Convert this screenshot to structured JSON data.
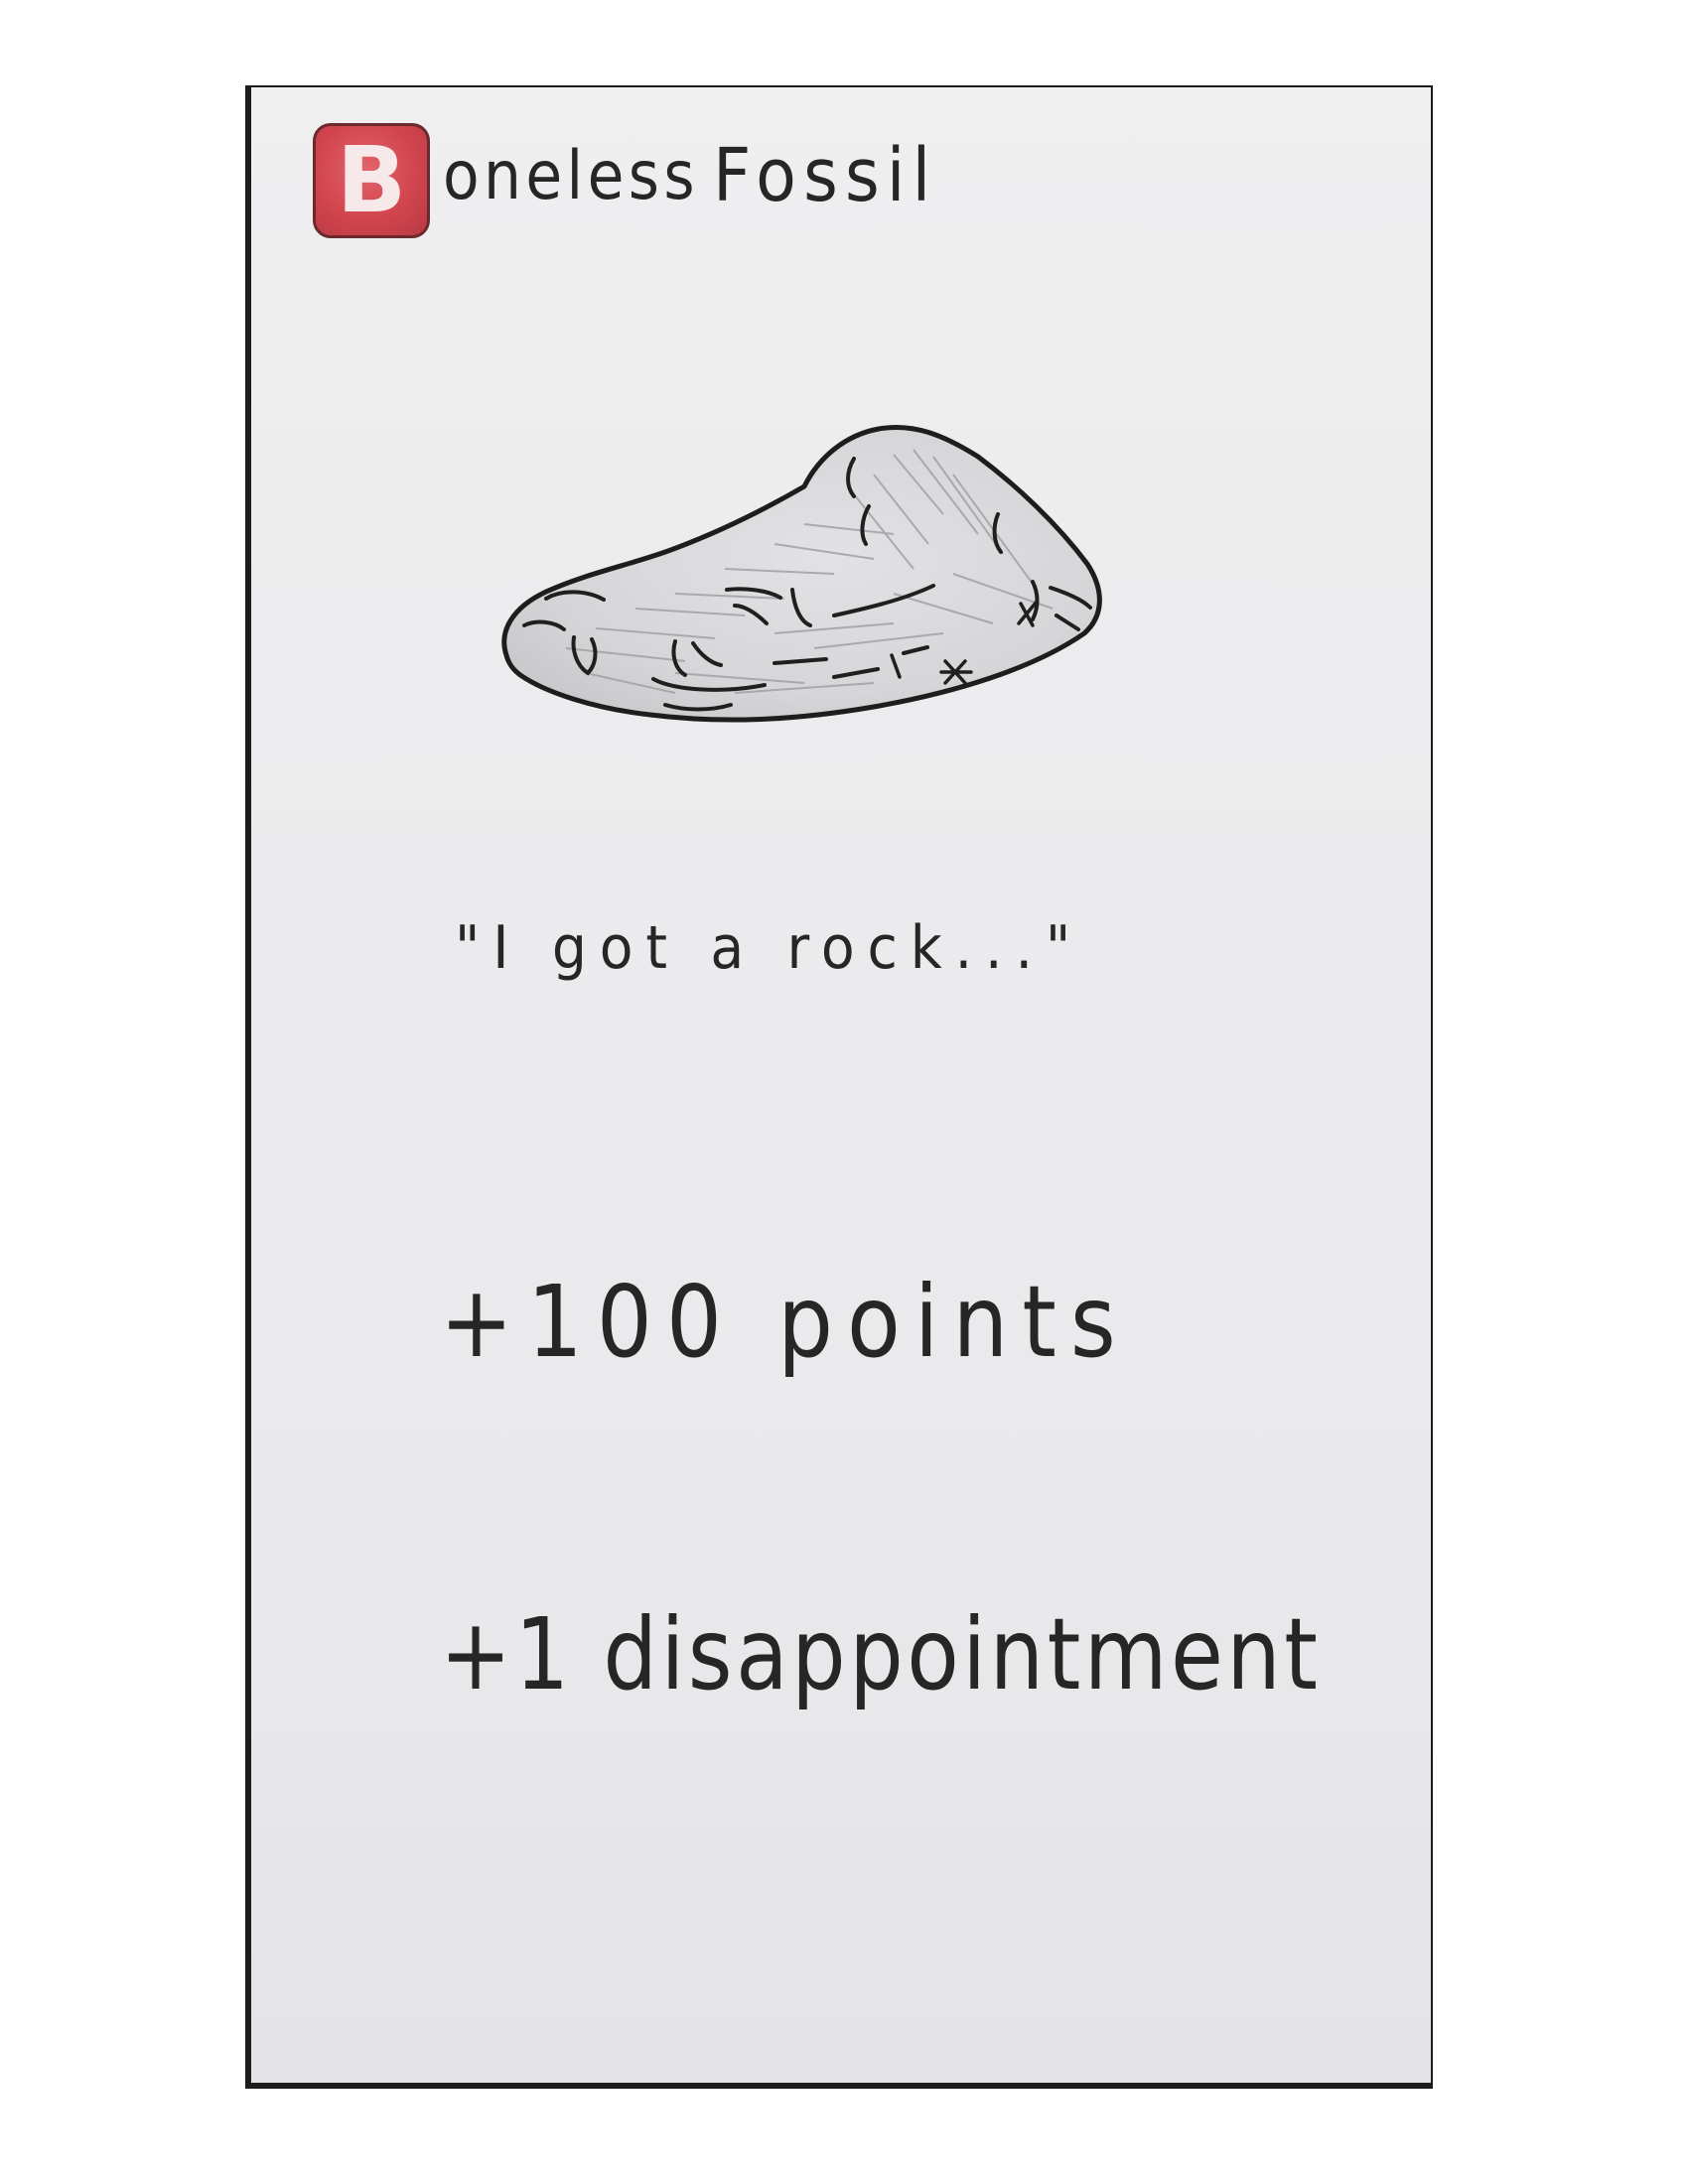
{
  "card": {
    "title_initial": "B",
    "title_rest": "oneless",
    "title_second": "Fossil",
    "illustration_icon": "rock-icon",
    "quote": "\"I got a rock...\"",
    "points_reward": "+100 points",
    "bonus_reward": "+1 disappointment"
  },
  "colors": {
    "badge": "#d2454e",
    "ink": "#262626",
    "paper": "#ebebed"
  }
}
